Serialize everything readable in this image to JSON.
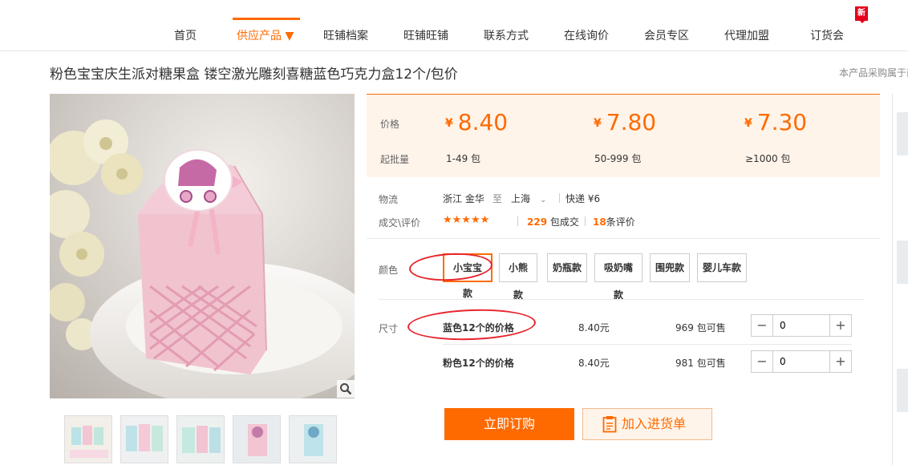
{
  "nav": {
    "items": [
      {
        "label": "首页"
      },
      {
        "label": "供应产品"
      },
      {
        "label": "旺铺档案"
      },
      {
        "label": "旺铺旺铺"
      },
      {
        "label": "联系方式"
      },
      {
        "label": "在线询价"
      },
      {
        "label": "会员专区"
      },
      {
        "label": "代理加盟"
      },
      {
        "label": "订货会"
      }
    ],
    "active_arrow": "▼",
    "new_badge": "新"
  },
  "product": {
    "title": "粉色宝宝庆生派对糖果盒 镂空激光雕刻喜糖蓝色巧克力盒12个/包价",
    "right_note": "本产品采购属于商"
  },
  "pricing": {
    "price_label": "价格",
    "moq_label": "起批量",
    "currency": "¥",
    "tiers": [
      {
        "price": "8.40",
        "qty": "1-49 包"
      },
      {
        "price": "7.80",
        "qty": "50-999 包"
      },
      {
        "price": "7.30",
        "qty": "≥1000 包"
      }
    ]
  },
  "logistics": {
    "label": "物流",
    "from": "浙江 金华",
    "to_word": "至",
    "to": "上海",
    "method": "快递 ¥6"
  },
  "deals": {
    "label": "成交\\评价",
    "stars": "★★★★★",
    "sold_count": "229",
    "sold_suffix": "包成交",
    "review_count": "18",
    "review_suffix": "条评价"
  },
  "color": {
    "label": "颜色",
    "options": [
      "小宝宝款",
      "小熊款",
      "奶瓶款",
      "吸奶嘴款",
      "围兜款",
      "婴儿车款"
    ],
    "selected": "小宝宝款"
  },
  "size": {
    "label": "尺寸",
    "rows": [
      {
        "name": "蓝色12个的价格",
        "price": "8.40元",
        "stock": "969 包可售",
        "qty": "0"
      },
      {
        "name": "粉色12个的价格",
        "price": "8.40元",
        "stock": "981 包可售",
        "qty": "0"
      }
    ]
  },
  "actions": {
    "order": "立即订购",
    "cart": "加入进货单"
  },
  "colors": {
    "accent": "#ff6a00",
    "price_bg": "#fff4ea",
    "annotation": "#e8242c"
  }
}
